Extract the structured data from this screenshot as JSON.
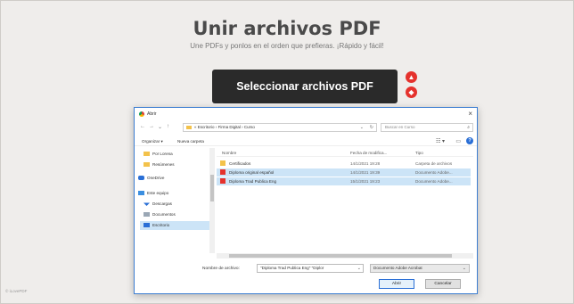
{
  "page": {
    "title": "Unir archivos PDF",
    "subtitle": "Une PDFs y ponlos en el orden que prefieras. ¡Rápido y fácil!",
    "select_button": "Seleccionar archivos PDF",
    "side_icons": [
      "google-drive-icon",
      "dropbox-icon"
    ],
    "footer": "© iLovePDF"
  },
  "dialog": {
    "title": "Abrir",
    "close": "×",
    "nav": {
      "back": "←",
      "forward": "→",
      "up_dropdown": "⌄",
      "up": "↑"
    },
    "address": {
      "parts": [
        "Escritorio",
        "Firma Digital",
        "Curso"
      ],
      "separator": "›",
      "prefix": "«"
    },
    "search_placeholder": "Buscar en Curso",
    "toolbar": {
      "organize": "Organizar ▾",
      "new_folder": "Nueva carpeta"
    },
    "sidebar": [
      {
        "label": "Por Lorena",
        "icon": "folder-icon",
        "selected": false
      },
      {
        "label": "Resúmenes",
        "icon": "folder-icon",
        "selected": false
      },
      {
        "label": "OneDrive",
        "icon": "onedrive-icon",
        "selected": false
      },
      {
        "label": "Este equipo",
        "icon": "computer-icon",
        "selected": false
      },
      {
        "label": "Descargas",
        "icon": "download-icon",
        "selected": false
      },
      {
        "label": "Documentos",
        "icon": "document-icon",
        "selected": false
      },
      {
        "label": "Escritorio",
        "icon": "desktop-icon",
        "selected": true
      }
    ],
    "columns": {
      "name": "Nombre",
      "date": "Fecha de modifica...",
      "type": "Tipo"
    },
    "files": [
      {
        "name": "Certificados",
        "date": "14/1/2021 19:28",
        "type": "Carpeta de archivos",
        "kind": "folder",
        "selected": false
      },
      {
        "name": "Diploma original español",
        "date": "14/1/2021 19:39",
        "type": "Documento Adobe...",
        "kind": "pdf",
        "selected": true
      },
      {
        "name": "Diploma Trad Publica Eng",
        "date": "15/1/2021 19:23",
        "type": "Documento Adobe...",
        "kind": "pdf",
        "selected": true
      }
    ],
    "filename_label": "Nombre de archivo:",
    "filename_value": "\"Diploma Trad Publica Eng\" \"Diplor",
    "filetype_value": "Documento Adobe Acrobat",
    "open_button": "Abrir",
    "cancel_button": "Cancelar"
  },
  "colors": {
    "accent": "#e5322d",
    "selection": "#cce4f7",
    "button_dark": "#2a2a2a"
  }
}
